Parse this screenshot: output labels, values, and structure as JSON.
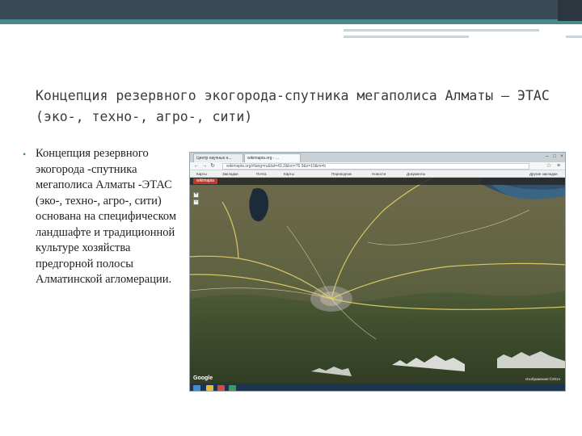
{
  "slide": {
    "title": "Концепция резервного экогорода-спутника мегаполиса Алматы – ЭТАС (эко-, техно-, агро-, сити)",
    "bullet_text": "Концепция резервного экогорода -спутника мегаполиса Алматы -ЭТАС (эко-, техно-, агро-, сити) основана на специфическом ландшафте и традиционной культуре хозяйства предгорной полосы Алматинской агломерации.",
    "colors": {
      "header_bar": "#3a4a56",
      "accent": "#4a8a8e"
    }
  },
  "browser": {
    "tabs": [
      "Центр научных н...",
      "wikimapia.org - ..."
    ],
    "url": "wikimapia.org/#lang=ru&lat=43.2&lon=76.9&z=10&m=b",
    "bookmarks": [
      "Карты",
      "Закладки",
      "Почта",
      "Карты",
      "Переводчик",
      "Новости",
      "Документы",
      "Другие закладки"
    ],
    "map": {
      "logo": "wikimapia",
      "google_label": "Google",
      "credit": "Изображения ©2014"
    }
  }
}
